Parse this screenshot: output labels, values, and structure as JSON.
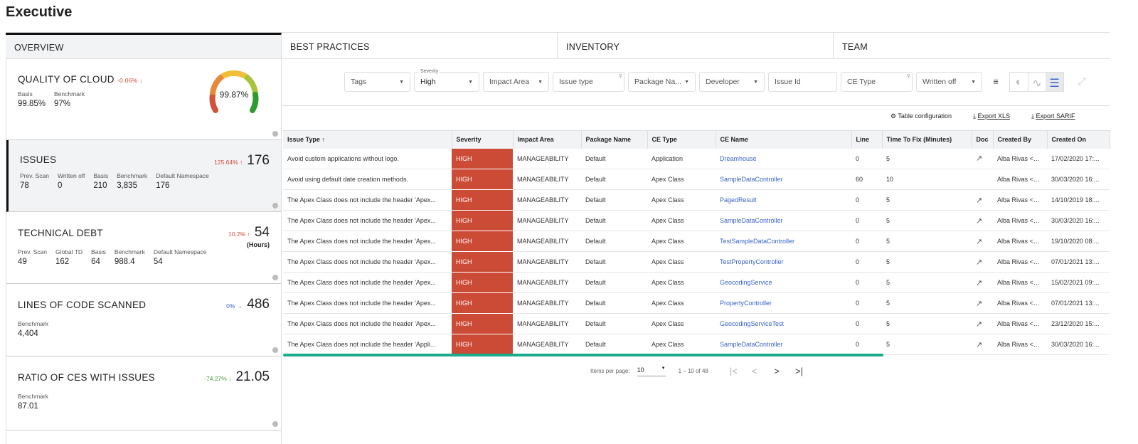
{
  "title": "Executive",
  "tabs": [
    "OVERVIEW",
    "BEST PRACTICES",
    "INVENTORY",
    "TEAM"
  ],
  "cards": {
    "quality": {
      "title": "QUALITY OF CLOUD",
      "delta": "-0.06% ↓",
      "gauge": "99.87%",
      "gauge_value": 99.87,
      "stats": [
        {
          "label": "Basis",
          "value": "99.85%"
        },
        {
          "label": "Benchmark",
          "value": "97%"
        }
      ]
    },
    "issues": {
      "title": "ISSUES",
      "delta": "125.64% ↑",
      "value": "176",
      "stats": [
        {
          "label": "Prev. Scan",
          "value": "78"
        },
        {
          "label": "Written off",
          "value": "0"
        },
        {
          "label": "Basis",
          "value": "210"
        },
        {
          "label": "Benchmark",
          "value": "3,835"
        },
        {
          "label": "Default Namespace",
          "value": "176"
        }
      ]
    },
    "debt": {
      "title": "TECHNICAL DEBT",
      "delta": "10.2% ↑",
      "value": "54",
      "unit": "(Hours)",
      "stats": [
        {
          "label": "Prev. Scan",
          "value": "49"
        },
        {
          "label": "Global TD",
          "value": "162"
        },
        {
          "label": "Basis",
          "value": "64"
        },
        {
          "label": "Benchmark",
          "value": "988.4"
        },
        {
          "label": "Default Namespace",
          "value": "54"
        }
      ]
    },
    "loc": {
      "title": "LINES OF CODE SCANNED",
      "delta": "0% →",
      "value": "486",
      "stats": [
        {
          "label": "Benchmark",
          "value": "4,404"
        }
      ]
    },
    "ratio": {
      "title": "RATIO OF CES WITH ISSUES",
      "delta": "-74.27% ↓",
      "value": "21.05",
      "stats": [
        {
          "label": "Benchmark",
          "value": "87.01"
        }
      ]
    }
  },
  "filters": {
    "tags": "Tags",
    "severity_label": "Severity",
    "severity": "High",
    "impact": "Impact Area",
    "issue_type": "Issue type",
    "package": "Package Na...",
    "developer": "Developer",
    "issue_id": "Issue Id",
    "ce_type": "CE Type",
    "written_off": "Written off"
  },
  "actions": {
    "config": "Table configuration",
    "xls": "Export XLS",
    "sarif": "Export SARIF"
  },
  "table": {
    "columns": [
      "Issue Type ↑",
      "Severity",
      "Impact Area",
      "Package Name",
      "CE Type",
      "CE Name",
      "Line",
      "Time To Fix (Minutes)",
      "Doc",
      "Created By",
      "Created On"
    ],
    "rows": [
      [
        "Avoid custom applications without logo.",
        "HIGH",
        "MANAGEABILITY",
        "Default",
        "Application",
        "Dreamhouse",
        "0",
        "5",
        true,
        "Alba Rivas <alb...",
        "17/02/2020 17:..."
      ],
      [
        "Avoid using default date creation methods.",
        "HIGH",
        "MANAGEABILITY",
        "Default",
        "Apex Class",
        "SampleDataController",
        "60",
        "10",
        false,
        "Alba Rivas <alb...",
        "30/03/2020 16:..."
      ],
      [
        "The Apex Class does not include the header 'Apex...",
        "HIGH",
        "MANAGEABILITY",
        "Default",
        "Apex Class",
        "PagedResult",
        "0",
        "5",
        true,
        "Alba Rivas <alb...",
        "14/10/2019 18:..."
      ],
      [
        "The Apex Class does not include the header 'Apex...",
        "HIGH",
        "MANAGEABILITY",
        "Default",
        "Apex Class",
        "SampleDataController",
        "0",
        "5",
        true,
        "Alba Rivas <alb...",
        "30/03/2020 16:..."
      ],
      [
        "The Apex Class does not include the header 'Apex...",
        "HIGH",
        "MANAGEABILITY",
        "Default",
        "Apex Class",
        "TestSampleDataController",
        "0",
        "5",
        true,
        "Alba Rivas <ariv...",
        "19/10/2020 08:..."
      ],
      [
        "The Apex Class does not include the header 'Apex...",
        "HIGH",
        "MANAGEABILITY",
        "Default",
        "Apex Class",
        "TestPropertyController",
        "0",
        "5",
        true,
        "Alba Rivas <ariv...",
        "07/01/2021 13:..."
      ],
      [
        "The Apex Class does not include the header 'Apex...",
        "HIGH",
        "MANAGEABILITY",
        "Default",
        "Apex Class",
        "GeocodingService",
        "0",
        "5",
        true,
        "Alba Rivas <ariv...",
        "15/02/2021 09:..."
      ],
      [
        "The Apex Class does not include the header 'Apex...",
        "HIGH",
        "MANAGEABILITY",
        "Default",
        "Apex Class",
        "PropertyController",
        "0",
        "5",
        true,
        "Alba Rivas <ariv...",
        "07/01/2021 13:..."
      ],
      [
        "The Apex Class does not include the header 'Apex...",
        "HIGH",
        "MANAGEABILITY",
        "Default",
        "Apex Class",
        "GeocodingServiceTest",
        "0",
        "5",
        true,
        "Alba Rivas <ariv...",
        "23/12/2020 15:..."
      ],
      [
        "The Apex Class does not include the header 'Appli...",
        "HIGH",
        "MANAGEABILITY",
        "Default",
        "Apex Class",
        "SampleDataController",
        "0",
        "5",
        true,
        "Alba Rivas <alb...",
        "30/03/2020 16:..."
      ]
    ]
  },
  "pagination": {
    "items_label": "Items per page:",
    "per_page": "10",
    "range": "1 – 10 of 48"
  },
  "colors": {
    "high": "#cc4b37",
    "link": "#3a63c9",
    "scroll": "#1aab8b"
  }
}
